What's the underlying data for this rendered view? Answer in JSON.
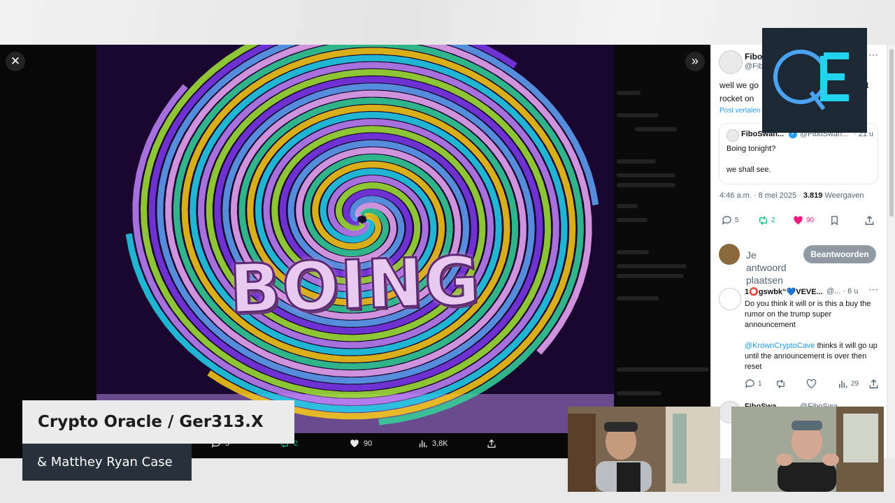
{
  "viewer": {
    "close_icon": "close-icon",
    "collapse_icon": "chevrons-right-icon",
    "image_text": "BOING",
    "media_actions": {
      "replies": "5",
      "retweets": "2",
      "likes": "90",
      "views": "3,8K"
    }
  },
  "tweet": {
    "author_name": "Fibo",
    "author_handle": "@Fib",
    "text_line1": "well we go",
    "text_line1_end": "t",
    "text_line2": "rocket on",
    "translate_link": "Post vertalen",
    "quote": {
      "author_name": "FiboSwan...",
      "author_handle": "@FiboSwan...",
      "time": "21 u",
      "text1": "Boing tonight?",
      "text2": "we shall see."
    },
    "timestamp": "4:46 a.m. · 8 mei 2025 ·",
    "views_count": "3.819",
    "views_label": "Weergaven",
    "stats": {
      "replies": "5",
      "retweets": "2",
      "likes": "90"
    }
  },
  "reply_composer": {
    "placeholder_line1": "Je",
    "placeholder_line2": "antwoord",
    "placeholder_line3": "plaatsen",
    "button_label": "Beantwoorden"
  },
  "reply": {
    "author_name": "1⭕gswbk“💙VEVE...",
    "author_handle": "@...",
    "time": "6 u",
    "text1": "Do you think it will or is this a buy the rumor on the trump super announcement",
    "mention": "@KrownCryptoCave",
    "text2": " thinks it will go up until the announcement is over then reset",
    "stats": {
      "replies": "1",
      "views": "29"
    }
  },
  "next_reply": {
    "author_name": "FiboSwa...",
    "author_handle": "@FiboSwa..."
  },
  "overlay": {
    "logo_text": "QE",
    "lower_third_title": "Crypto Oracle / Ger313.X",
    "lower_third_subtitle": "& Matthey Ryan Case"
  },
  "colors": {
    "like": "#f91880",
    "retweet": "#00ba7c",
    "link": "#1d9bf0",
    "logo_bg": "#1c2833",
    "logo_q": "#4aa3f0",
    "logo_e": "#22d3ee"
  }
}
